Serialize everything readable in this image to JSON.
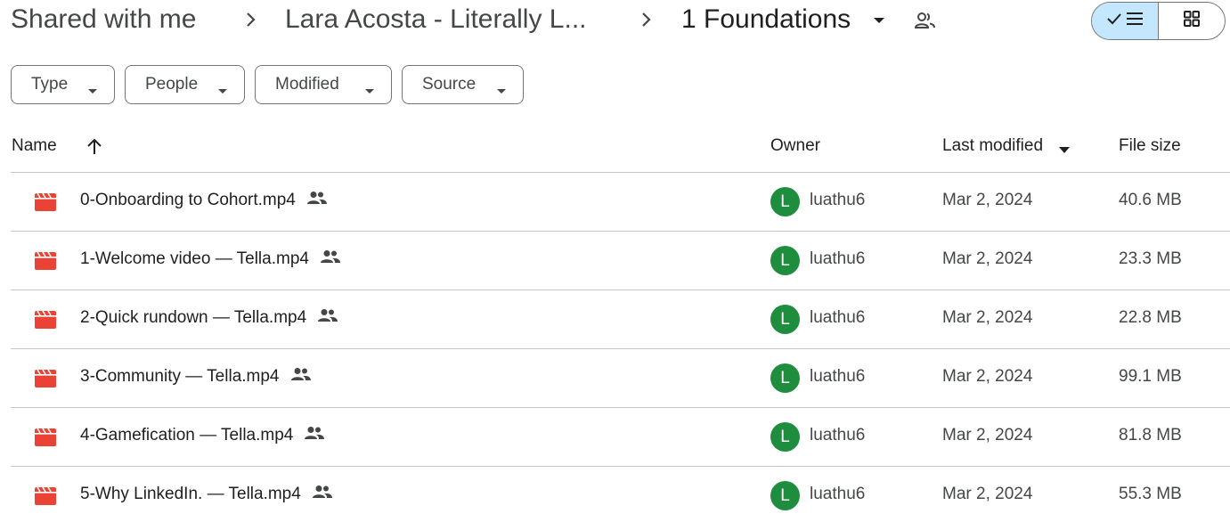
{
  "breadcrumb": {
    "items": [
      {
        "label": "Shared with me"
      },
      {
        "label": "Lara Acosta - Literally L..."
      },
      {
        "label": "1 Foundations"
      }
    ]
  },
  "view_toggle": {
    "active": "list"
  },
  "filters": [
    {
      "label": "Type"
    },
    {
      "label": "People"
    },
    {
      "label": "Modified"
    },
    {
      "label": "Source"
    }
  ],
  "columns": {
    "name": "Name",
    "owner": "Owner",
    "last_modified": "Last modified",
    "file_size": "File size"
  },
  "files": [
    {
      "name": "0-Onboarding to Cohort.mp4",
      "owner": "luathu6",
      "avatar": "L",
      "modified": "Mar 2, 2024",
      "size": "40.6 MB"
    },
    {
      "name": "1-Welcome video — Tella.mp4",
      "owner": "luathu6",
      "avatar": "L",
      "modified": "Mar 2, 2024",
      "size": "23.3 MB"
    },
    {
      "name": "2-Quick rundown — Tella.mp4",
      "owner": "luathu6",
      "avatar": "L",
      "modified": "Mar 2, 2024",
      "size": "22.8 MB"
    },
    {
      "name": "3-Community — Tella.mp4",
      "owner": "luathu6",
      "avatar": "L",
      "modified": "Mar 2, 2024",
      "size": "99.1 MB"
    },
    {
      "name": "4-Gamefication — Tella.mp4",
      "owner": "luathu6",
      "avatar": "L",
      "modified": "Mar 2, 2024",
      "size": "81.8 MB"
    },
    {
      "name": "5-Why LinkedIn. — Tella.mp4",
      "owner": "luathu6",
      "avatar": "L",
      "modified": "Mar 2, 2024",
      "size": "55.3 MB"
    }
  ],
  "colors": {
    "video_icon": "#ea4335",
    "avatar_bg": "#1e8e3e",
    "toggle_active_bg": "#c2e7ff"
  },
  "icons": {
    "file": "video-file-icon",
    "shared": "shared-people-icon",
    "sort": "arrow-up-icon"
  }
}
